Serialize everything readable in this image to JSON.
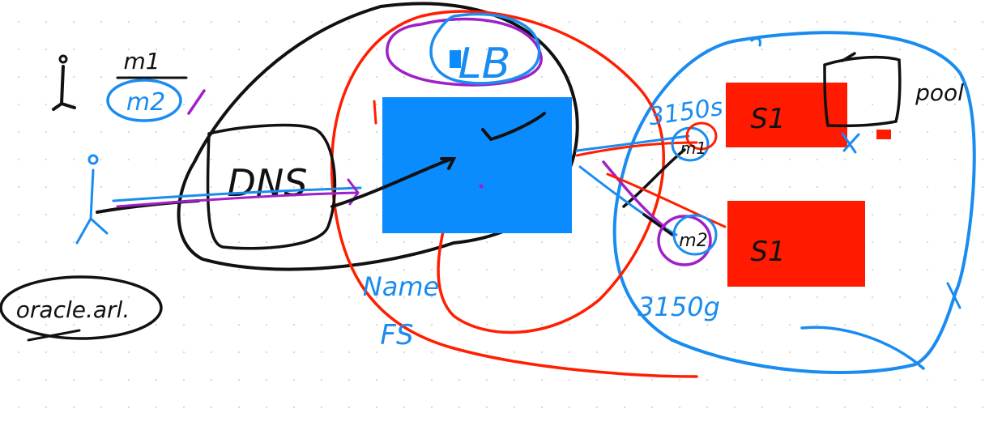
{
  "colors": {
    "ink_black": "#111111",
    "ink_blue": "#1a8cf0",
    "ink_red": "#ff1e00",
    "ink_purple": "#a020c8",
    "block_blue": "#0a8cff",
    "block_red": "#ff1a00"
  },
  "labels": {
    "m1_top": "m1",
    "m2_top": "m2",
    "dns": "DNS",
    "lb": "LB",
    "oracle": "oracle.arl.",
    "name_fs": "Name",
    "fs": "FS",
    "port_top": "3150s",
    "port_bottom": "3150g",
    "s1_top": "S1",
    "s1_bottom": "S1",
    "m1_node": "m1",
    "m2_node": "m2",
    "pool": "pool"
  }
}
